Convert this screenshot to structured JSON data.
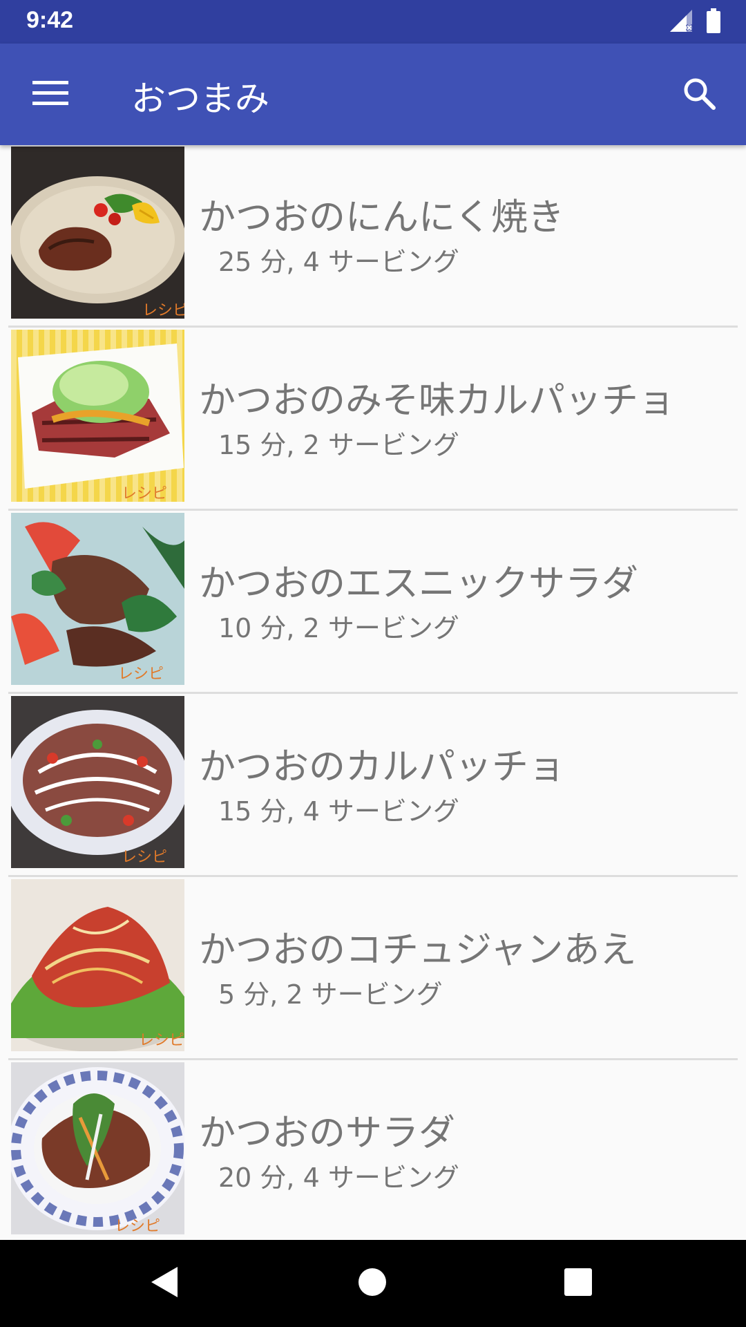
{
  "status_bar": {
    "time": "9:42",
    "icons": [
      "signal-icon",
      "battery-icon"
    ]
  },
  "app_bar": {
    "title": "おつまみ",
    "icons": [
      "menu-icon",
      "search-icon"
    ]
  },
  "recipes": [
    {
      "title": "かつおのにんにく焼き",
      "meta": "25 分, 4 サービング",
      "image": "garlic-grilled-bonito-photo"
    },
    {
      "title": "かつおのみそ味カルパッチョ",
      "meta": "15 分, 2 サービング",
      "image": "miso-carpaccio-photo"
    },
    {
      "title": "かつおのエスニックサラダ",
      "meta": "10 分, 2 サービング",
      "image": "ethnic-salad-photo"
    },
    {
      "title": "かつおのカルパッチョ",
      "meta": "15 分, 4 サービング",
      "image": "carpaccio-photo"
    },
    {
      "title": "かつおのコチュジャンあえ",
      "meta": "5 分, 2 サービング",
      "image": "gochujang-dressed-photo"
    },
    {
      "title": "かつおのサラダ",
      "meta": "20 分, 4 サービング",
      "image": "bonito-salad-photo"
    }
  ],
  "nav_bar": {
    "icons": [
      "back-icon",
      "home-icon",
      "recents-icon"
    ]
  },
  "colors": {
    "status_bar": "#303f9f",
    "app_bar": "#3f51b5",
    "background": "#fafafa",
    "text": "#757575",
    "nav_bar": "#000000"
  }
}
